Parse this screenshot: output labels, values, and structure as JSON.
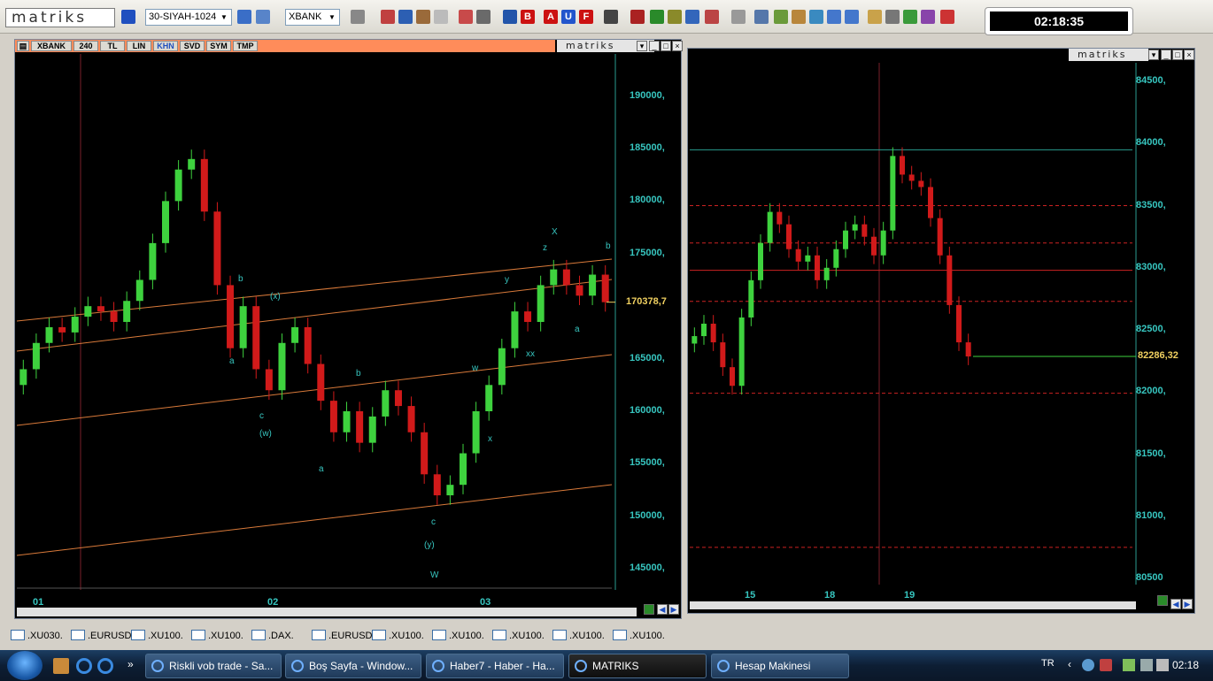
{
  "toolbar": {
    "logo": "matriks",
    "template": "30-SIYAH-1024",
    "symbol": "XBANK",
    "clock": "02:18:35",
    "colors": {
      "accent_red": "#cc0000",
      "accent_blue": "#1f4fbf"
    }
  },
  "left_panel": {
    "tabs": [
      "XBANK",
      "240",
      "TL",
      "LIN",
      "KHN",
      "SVD",
      "SYM",
      "TMP"
    ],
    "active_tab": "KHN",
    "brand": "matriks",
    "price_labels": [
      "190000,",
      "185000,",
      "180000,",
      "175000,",
      "170378,7",
      "165000,",
      "160000,",
      "155000,",
      "150000,",
      "145000,"
    ],
    "x_labels": [
      "01",
      "02",
      "03"
    ],
    "wave_labels": [
      "b",
      "(x)",
      "a",
      "c",
      "(w)",
      "a",
      "b",
      "c",
      "(y)",
      "W",
      "w",
      "x",
      "y",
      "z",
      "X",
      "xx",
      "a",
      "b"
    ]
  },
  "right_panel": {
    "brand": "matriks",
    "price_labels": [
      "84500,",
      "84000,",
      "83500,",
      "83000,",
      "82500,",
      "82286,32",
      "82000,",
      "81500,",
      "81000,",
      "80500"
    ],
    "x_labels": [
      "15",
      "18",
      "19"
    ]
  },
  "chart_data": [
    {
      "type": "candlestick",
      "title": "",
      "symbol": "XBANK",
      "interval": "240",
      "ylim": [
        143000,
        194000
      ],
      "current_price": 170378.7,
      "x": [
        "01",
        "02",
        "03"
      ],
      "closes": [
        164000,
        166500,
        168000,
        167500,
        169000,
        170000,
        169500,
        168500,
        170500,
        172500,
        176000,
        180000,
        183000,
        184000,
        179000,
        172000,
        166000,
        170000,
        164000,
        162000,
        166500,
        168000,
        164500,
        161000,
        158000,
        160000,
        157000,
        159500,
        162000,
        160500,
        158000,
        154000,
        152000,
        153000,
        156000,
        160000,
        162500,
        166000,
        169500,
        168500,
        172000,
        173500,
        172000,
        171000,
        173000,
        170378.7
      ]
    },
    {
      "type": "candlestick",
      "title": "",
      "ylim": [
        80450,
        84650
      ],
      "current_price": 82286.32,
      "x": [
        "15",
        "18",
        "19"
      ],
      "closes": [
        82450,
        82550,
        82400,
        82200,
        82050,
        82600,
        82900,
        83200,
        83450,
        83350,
        83150,
        83050,
        83100,
        82900,
        83000,
        83150,
        83300,
        83350,
        83250,
        83100,
        83300,
        83900,
        83750,
        83700,
        83650,
        83400,
        83100,
        82700,
        82400,
        82286.32
      ],
      "levels": [
        {
          "value": 83950,
          "color": "#2a9d8f",
          "style": "solid"
        },
        {
          "value": 83500,
          "color": "#cc2222",
          "style": "dashed"
        },
        {
          "value": 83200,
          "color": "#cc2222",
          "style": "dashed"
        },
        {
          "value": 82980,
          "color": "#cc2222",
          "style": "solid"
        },
        {
          "value": 82730,
          "color": "#cc2222",
          "style": "dashed"
        },
        {
          "value": 81990,
          "color": "#cc2222",
          "style": "dashed"
        },
        {
          "value": 80750,
          "color": "#cc2222",
          "style": "dashed"
        }
      ]
    }
  ],
  "symbol_tabs": [
    ".XU030.",
    ".EURUSD.",
    ".XU100.",
    ".XU100.",
    ".DAX.",
    ".EURUSD.",
    ".XU100.",
    ".XU100.",
    ".XU100.",
    ".XU100.",
    ".XU100."
  ],
  "taskbar": {
    "buttons": [
      "Riskli vob trade - Sa...",
      "Boş Sayfa - Window...",
      "Haber7 - Haber - Ha...",
      "MATRIKS",
      "Hesap Makinesi"
    ],
    "active": "MATRIKS",
    "lang": "TR",
    "time": "02:18"
  }
}
